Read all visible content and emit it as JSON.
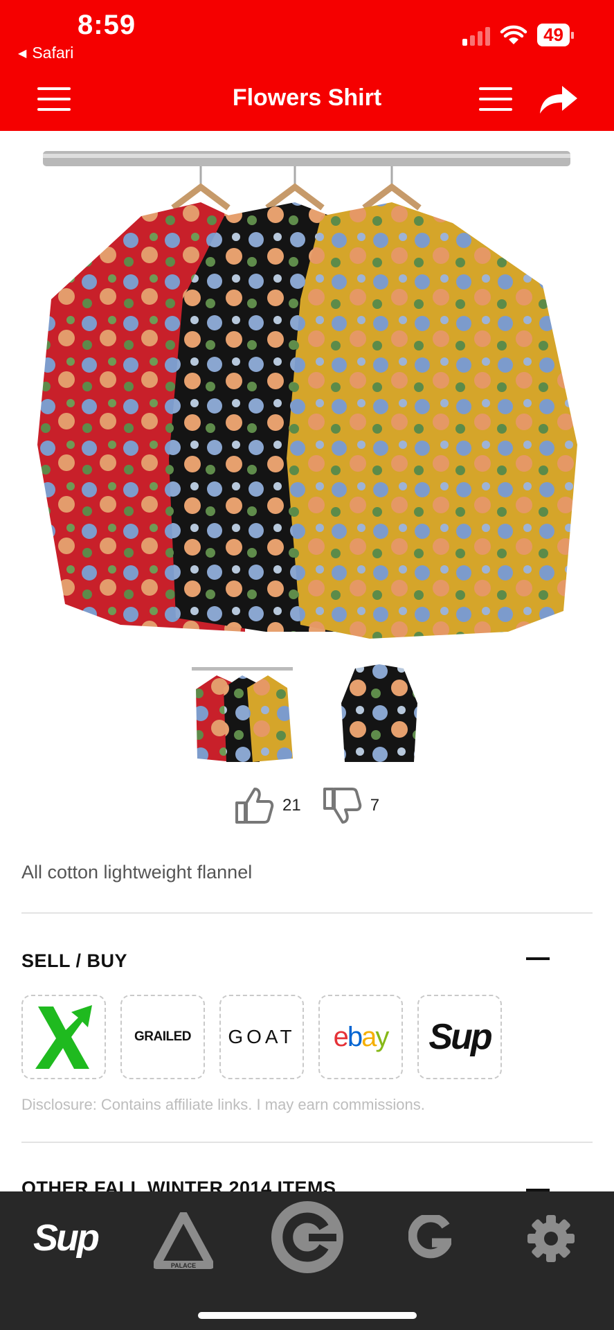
{
  "status_bar": {
    "time": "8:59",
    "back_app": "Safari",
    "battery": "49"
  },
  "header": {
    "title": "Flowers Shirt"
  },
  "product": {
    "votes": {
      "up": "21",
      "down": "7"
    },
    "description": "All cotton lightweight flannel"
  },
  "sell_buy": {
    "title": "SELL / BUY",
    "stores": [
      {
        "name": "StockX",
        "icon": "stockx-x-logo"
      },
      {
        "name": "GRAILED"
      },
      {
        "name": "GOAT"
      },
      {
        "name": "ebay"
      },
      {
        "name": "Sup"
      }
    ],
    "disclosure": "Disclosure: Contains affiliate links. I may earn commissions."
  },
  "other_items": {
    "title": "OTHER FALL WINTER 2014 ITEMS"
  },
  "tabbar": {
    "tabs": [
      {
        "label": "Sup",
        "icon": "sup-logo"
      },
      {
        "label": "PALACE",
        "icon": "palace-triangle-icon"
      },
      {
        "icon": "c-logo-icon"
      },
      {
        "icon": "g-logo-icon"
      },
      {
        "icon": "gear-icon"
      }
    ]
  },
  "colors": {
    "brand_red": "#f50000",
    "tabbar_bg": "#282828"
  }
}
